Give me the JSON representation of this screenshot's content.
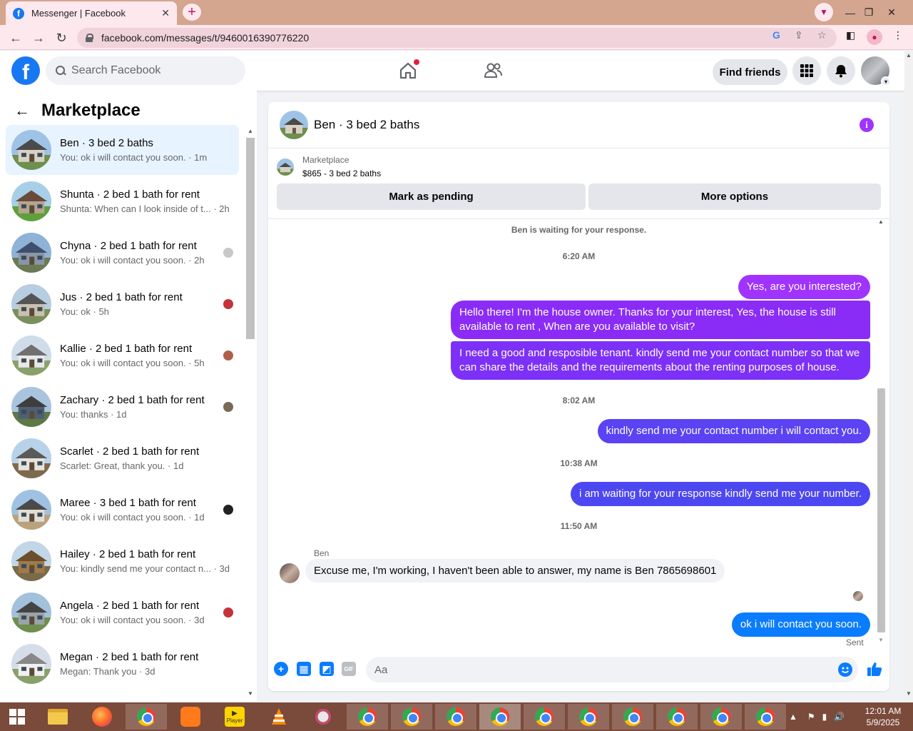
{
  "browser": {
    "tab_title": "Messenger | Facebook",
    "tab_close": "✕",
    "new_tab": "+",
    "address": "facebook.com/messages/t/9460016390776220"
  },
  "fb": {
    "search_placeholder": "Search Facebook",
    "find_friends": "Find friends"
  },
  "sidebar": {
    "title": "Marketplace",
    "conversations": [
      {
        "title": "Ben · 3 bed 2 baths",
        "preview": "You: ok i will contact you soon. · 1m",
        "active": true
      },
      {
        "title": "Shunta · 2 bed 1 bath for rent",
        "preview": "Shunta: When can I look inside of t... · 2h"
      },
      {
        "title": "Chyna · 2 bed 1 bath for rent",
        "preview": "You: ok i will contact you soon. · 2h"
      },
      {
        "title": "Jus · 2 bed 1 bath for rent",
        "preview": "You: ok · 5h"
      },
      {
        "title": "Kallie · 2 bed 1 bath for rent",
        "preview": "You: ok i will contact you soon. · 5h"
      },
      {
        "title": "Zachary · 2 bed 1 bath for rent",
        "preview": "You: thanks · 1d"
      },
      {
        "title": "Scarlet · 2 bed 1 bath for rent",
        "preview": "Scarlet: Great, thank you. · 1d"
      },
      {
        "title": "Maree · 3 bed 1 bath for rent",
        "preview": "You: ok i will contact you soon. · 1d"
      },
      {
        "title": "Hailey · 2 bed 1 bath for rent",
        "preview": "You: kindly send me your contact n... · 3d"
      },
      {
        "title": "Angela · 2 bed 1 bath for rent",
        "preview": "You: ok i will contact you soon. · 3d"
      },
      {
        "title": "Megan · 2 bed 1 bath for rent",
        "preview": "Megan: Thank you · 3d"
      }
    ]
  },
  "chat": {
    "title": "Ben · 3 bed 2 baths",
    "marketplace_label": "Marketplace",
    "listing": "$865 - 3 bed 2 baths",
    "mark_pending": "Mark as pending",
    "more_options": "More options",
    "waiting_note": "Ben is waiting for your response.",
    "time1": "6:20 AM",
    "msg1": "Yes, are you interested?",
    "msg2": "Hello there! I'm the house owner. Thanks for your interest, Yes, the house is still available to rent , When are you available to visit?",
    "msg3": "I need a good and resposible tenant.  kindly send me your contact number so that we can share the details and the requirements about the renting purposes of house.",
    "time2": "8:02 AM",
    "msg4": "kindly send me your contact number i will contact you.",
    "time3": "10:38 AM",
    "msg5": "i am waiting for your response kindly send me your number.",
    "time4": "11:50 AM",
    "sender": "Ben",
    "incoming": "Excuse me, I'm working, I haven't been able to answer, my name is Ben 7865698601",
    "msg6": "ok i will contact you soon.",
    "sent_status": "Sent",
    "composer_placeholder": "Aa",
    "gif_label": "GIF"
  },
  "taskbar": {
    "time": "12:01 AM",
    "date": "5/9/2025",
    "player_label": "Player"
  },
  "colors": {
    "fb_blue": "#1877f2",
    "bubble_purple": "#a033ff",
    "bubble_blue": "#0a7cff",
    "active_row": "#e7f3ff"
  }
}
